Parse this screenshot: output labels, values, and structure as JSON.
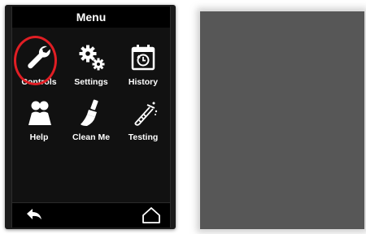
{
  "menu": {
    "title": "Menu",
    "tiles": [
      {
        "label": "Controls",
        "icon": "wrench-icon",
        "selected": true
      },
      {
        "label": "Settings",
        "icon": "gears-icon",
        "selected": false
      },
      {
        "label": "History",
        "icon": "calendar-clock-icon",
        "selected": false
      },
      {
        "label": "Help",
        "icon": "people-icon",
        "selected": false
      },
      {
        "label": "Clean Me",
        "icon": "brush-icon",
        "selected": false
      },
      {
        "label": "Testing",
        "icon": "test-tube-icon",
        "selected": false
      }
    ]
  },
  "nav": {
    "back_icon": "back-arrow-icon",
    "home_icon": "home-icon"
  },
  "colors": {
    "screen_background": "#111111",
    "highlight": "#e01e24",
    "text": "#ffffff",
    "preview_panel": "#575757"
  }
}
